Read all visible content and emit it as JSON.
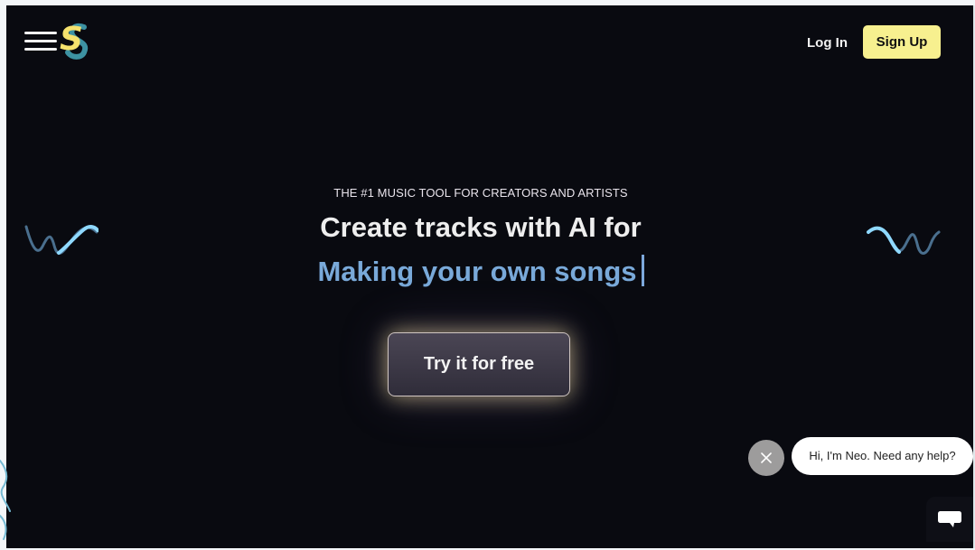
{
  "header": {
    "logo_text": "S",
    "login_label": "Log In",
    "signup_label": "Sign Up"
  },
  "hero": {
    "eyebrow": "THE #1 MUSIC TOOL FOR CREATORS AND ARTISTS",
    "headline": "Create tracks with AI for",
    "subheadline": "Making your own songs",
    "cta_label": "Try it for free"
  },
  "chat": {
    "message": "Hi, I'm Neo. Need any help?"
  },
  "icons": {
    "menu": "menu-icon",
    "close": "close-icon",
    "chat": "chat-icon",
    "wave": "wave-icon"
  },
  "colors": {
    "background": "#090a10",
    "signup": "#f7f08f",
    "accent_blue": "#79a9d9",
    "logo_yellow": "#f5e26d",
    "logo_teal": "#3d92a2"
  }
}
